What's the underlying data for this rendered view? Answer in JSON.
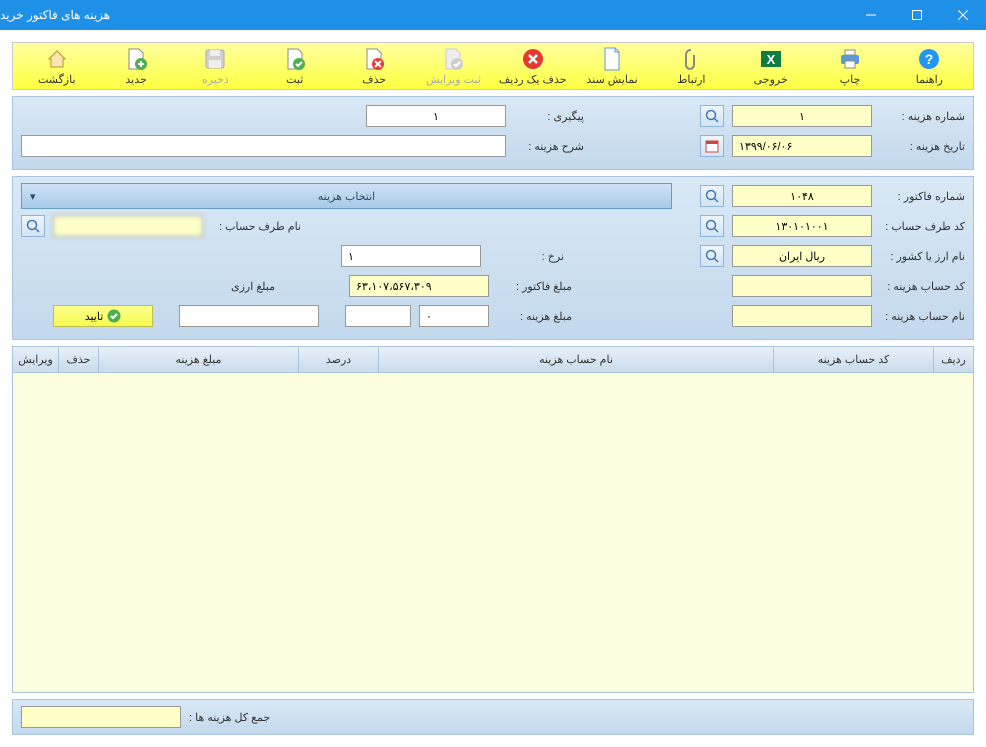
{
  "window": {
    "title": "هزینه های فاکتور خرید"
  },
  "toolbar": {
    "back": "بازگشت",
    "new": "جدید",
    "save": "ذخیره",
    "submit": "ثبت",
    "delete": "حذف",
    "submit_edit": "ثبت ویرایش",
    "delete_row": "حذف یک ردیف",
    "show_doc": "نمایش سند",
    "link": "ارتباط",
    "export": "خروجی",
    "print": "چاپ",
    "help": "راهنما"
  },
  "fields": {
    "cost_no_label": "شماره هزینه :",
    "cost_no": "۱",
    "cost_date_label": "تاریخ هزینه :",
    "cost_date": "۱۳۹۹/۰۶/۰۶",
    "followup_label": "پیگیری :",
    "followup": "۱",
    "cost_desc_label": "شرح هزینه :",
    "cost_desc": "",
    "invoice_no_label": "شماره فاکتور :",
    "invoice_no": "۱۰۴۸",
    "select_cost": "انتخاب هزینه",
    "party_code_label": "کد طرف حساب :",
    "party_code": "۱۳۰۱۰۱۰۰۱",
    "party_name_label": "نام طرف حساب :",
    "party_name": "",
    "currency_label": "نام ارز یا کشور :",
    "currency": "ریال ایران",
    "rate_label": "نرخ :",
    "rate": "۱",
    "cost_acc_code_label": "کد حساب هزینه :",
    "cost_acc_code": "",
    "invoice_amount_label": "مبلغ فاکتور :",
    "invoice_amount": "۶۳،۱۰۷،۵۶۷،۳۰۹",
    "currency_amount_label": "مبلغ ارزی",
    "currency_amount": "",
    "cost_acc_name_label": "نام حساب هزینه :",
    "cost_acc_name": "",
    "cost_amount_label": "مبلغ هزینه :",
    "cost_amount": "۰",
    "cost_amount2": "",
    "confirm": "تایید"
  },
  "table": {
    "h_row": "ردیف",
    "h_code": "کد حساب هزینه",
    "h_name": "نام حساب هزینه",
    "h_pct": "درصد",
    "h_amt": "مبلغ هزینه",
    "h_del": "حذف",
    "h_edit": "ویرایش"
  },
  "footer": {
    "total_label": "جمع کل هزینه ها :",
    "total": ""
  }
}
